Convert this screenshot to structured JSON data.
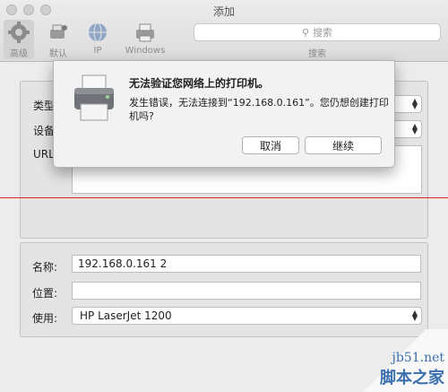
{
  "window": {
    "title": "添加",
    "toolbar": [
      {
        "label": "高级",
        "icon": "gear-icon"
      },
      {
        "label": "默认",
        "icon": "printer-person-icon"
      },
      {
        "label": "IP",
        "icon": "globe-icon"
      },
      {
        "label": "Windows",
        "icon": "printer-icon"
      }
    ],
    "search": {
      "placeholder": "搜索",
      "caption": "搜索"
    }
  },
  "form": {
    "type_label": "类型",
    "device_label": "设备",
    "url_label": "URL",
    "name_label": "名称:",
    "name_value": "192.168.0.161 2",
    "location_label": "位置:",
    "location_value": "",
    "use_label": "使用:",
    "use_value": "HP LaserJet 1200"
  },
  "dialog": {
    "title": "无法验证您网络上的打印机。",
    "message": "发生错误，无法连接到“192.168.0.161”。您仍想创建打印机吗?",
    "cancel_label": "取消",
    "continue_label": "继续"
  },
  "watermark": {
    "url": "jb51.net",
    "text": "脚本之家"
  },
  "colors": {
    "annotation_line": "#e32424",
    "watermark": "#3a6fb0"
  }
}
